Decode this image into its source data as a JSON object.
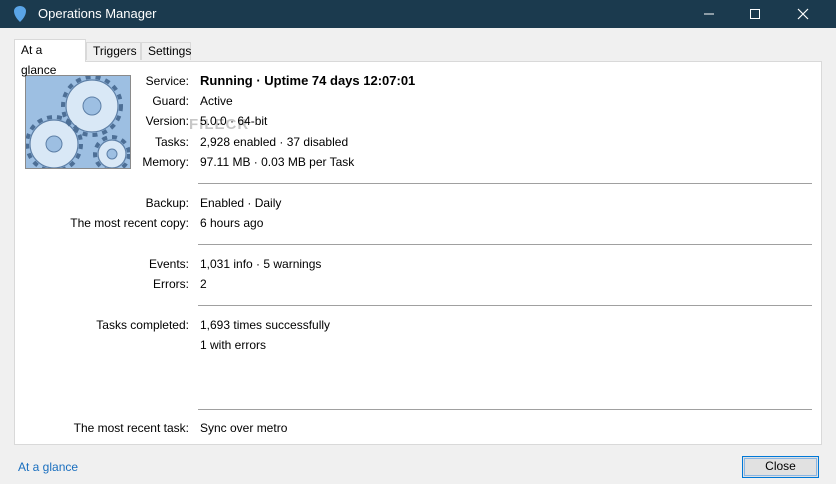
{
  "window": {
    "title": "Operations Manager",
    "icon": "shield-icon",
    "controls": [
      "minimize-icon",
      "maximize-icon",
      "close-icon"
    ]
  },
  "tabs": [
    {
      "label": "At a glance",
      "active": true
    },
    {
      "label": "Triggers",
      "active": false
    },
    {
      "label": "Settings",
      "active": false
    }
  ],
  "watermark": "FILECR",
  "status": {
    "service_label": "Service:",
    "service_value": "Running · Uptime 74 days 12:07:01",
    "guard_label": "Guard:",
    "guard_value": "Active",
    "version_label": "Version:",
    "version_value": "5.0.0 · 64-bit",
    "tasks_label": "Tasks:",
    "tasks_value": "2,928 enabled · 37 disabled",
    "memory_label": "Memory:",
    "memory_value": "97.11 MB · 0.03 MB per Task"
  },
  "backup": {
    "backup_label": "Backup:",
    "backup_value": "Enabled · Daily",
    "recent_copy_label": "The most recent copy:",
    "recent_copy_value": "6 hours ago"
  },
  "events": {
    "events_label": "Events:",
    "events_value": "1,031 info · 5 warnings",
    "errors_label": "Errors:",
    "errors_value": "2"
  },
  "completed": {
    "label": "Tasks completed:",
    "success_value": "1,693 times successfully",
    "errors_value": "1 with errors"
  },
  "recent_task": {
    "label": "The most recent task:",
    "value": "Sync over metro"
  },
  "footer": {
    "link": "At a glance",
    "close_button": "Close"
  },
  "colors": {
    "titlebar": "#1b3a4e",
    "link": "#1a6fbf",
    "button_border": "#0078d7"
  }
}
